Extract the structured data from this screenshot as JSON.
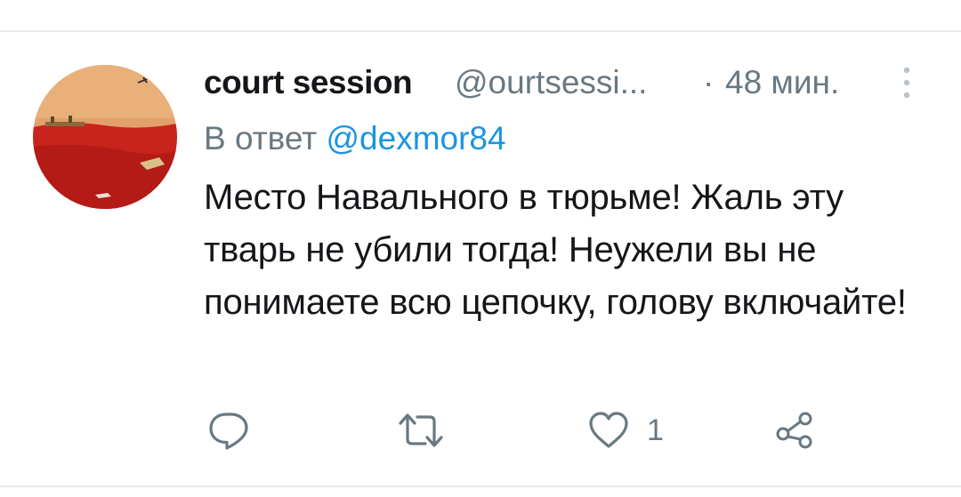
{
  "tweet": {
    "author_name": "court session",
    "author_handle": "@ourtsessi...",
    "separator": "·",
    "time": "48 мин.",
    "reply_prefix": "В ответ",
    "reply_to": "@dexmor84",
    "text": "Место Навального в тюрьме! Жаль эту тварь не убили тогда! Неужели вы не понимаете всю цепочку, голову включайте!"
  },
  "actions": {
    "reply_icon": "reply-icon",
    "retweet_icon": "retweet-icon",
    "like_icon": "heart-icon",
    "like_count": "1",
    "share_icon": "share-icon"
  },
  "colors": {
    "text": "#141619",
    "secondary": "#697882",
    "link": "#1b95e0",
    "divider": "#e8ecef"
  }
}
